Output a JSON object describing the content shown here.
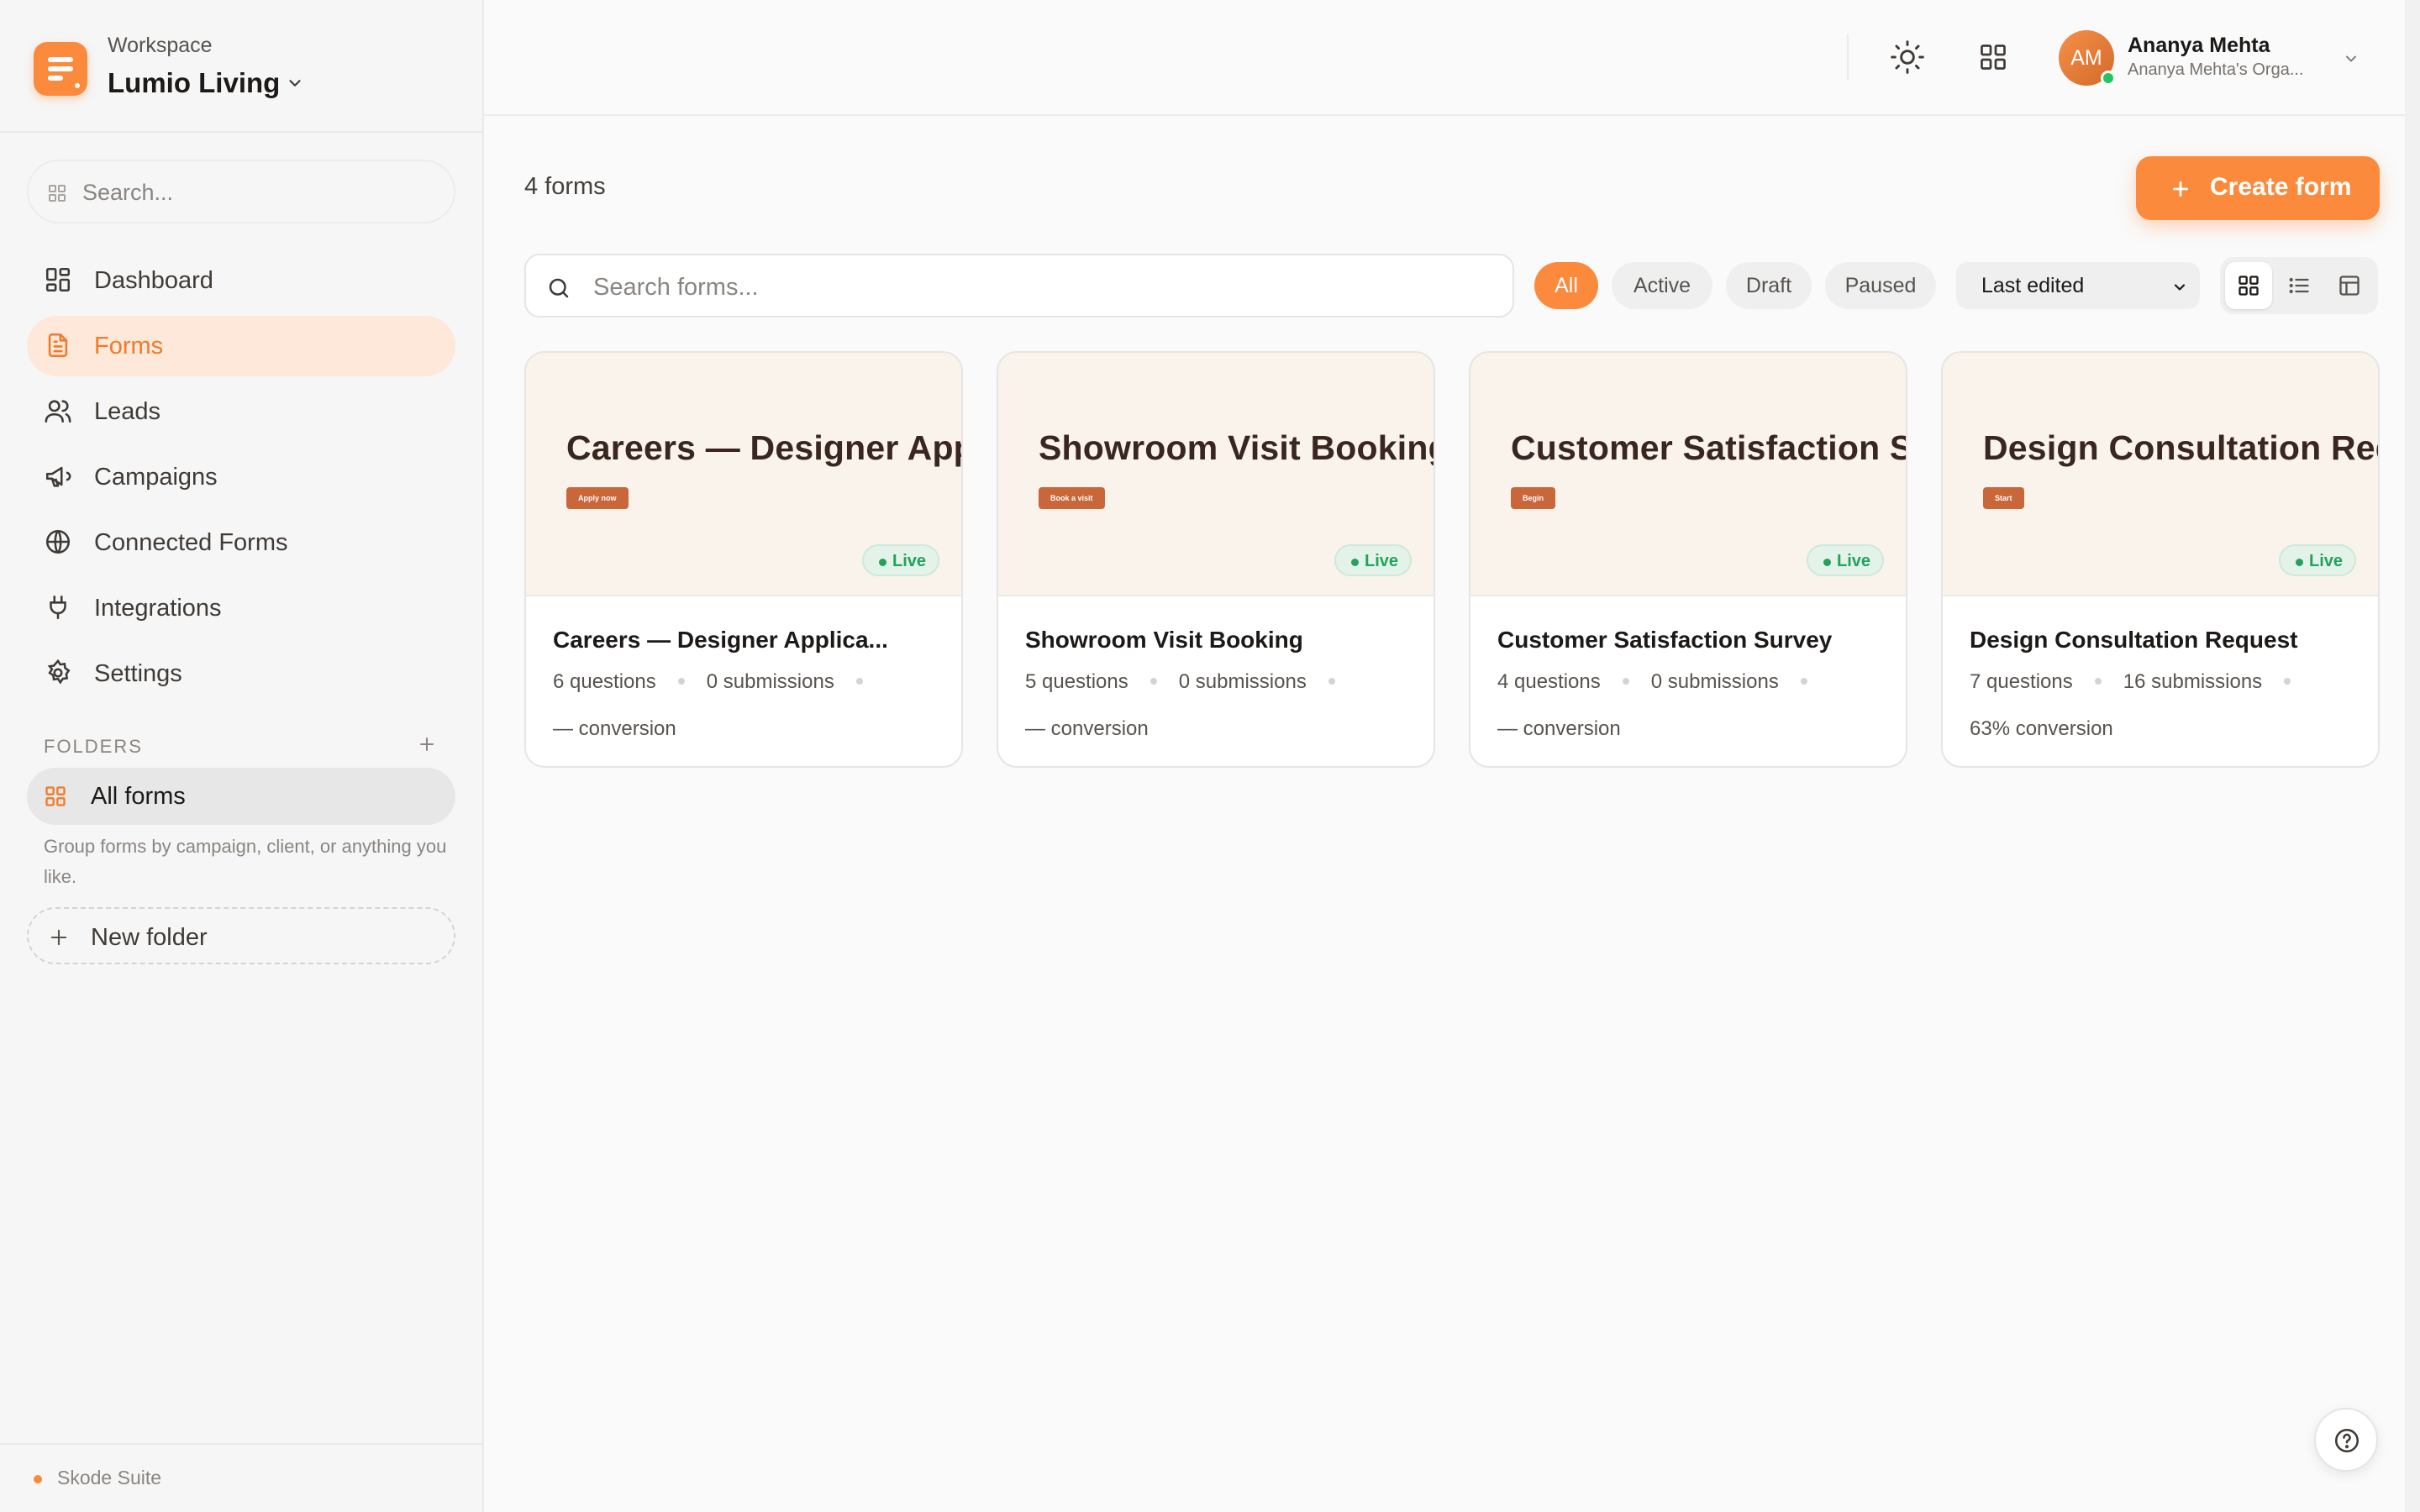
{
  "colors": {
    "accent": "#fb8a3c",
    "live": "#22a35a",
    "preview_bg": "#faf3ec",
    "preview_btn": "#c9663a"
  },
  "workspace": {
    "label": "Workspace",
    "name": "Lumio Living"
  },
  "sidebar": {
    "search_placeholder": "Search...",
    "nav": [
      {
        "label": "Dashboard",
        "icon": "dashboard-icon"
      },
      {
        "label": "Forms",
        "icon": "form-document-icon",
        "active": true
      },
      {
        "label": "Leads",
        "icon": "users-icon"
      },
      {
        "label": "Campaigns",
        "icon": "megaphone-icon"
      },
      {
        "label": "Connected Forms",
        "icon": "globe-icon"
      },
      {
        "label": "Integrations",
        "icon": "plug-icon"
      },
      {
        "label": "Settings",
        "icon": "gear-icon"
      }
    ],
    "folders_label": "FOLDERS",
    "all_forms_label": "All forms",
    "folders_help": "Group forms by campaign, client, or anything you like.",
    "new_folder_label": "New folder",
    "footer_brand": "Skode Suite"
  },
  "topbar": {
    "user_initials": "AM",
    "user_name": "Ananya Mehta",
    "user_org": "Ananya Mehta's Orga..."
  },
  "main": {
    "forms_count": "4 forms",
    "create_label": "Create form",
    "search_placeholder": "Search forms...",
    "filters": [
      "All",
      "Active",
      "Draft",
      "Paused"
    ],
    "active_filter": "All",
    "sort_value": "Last edited",
    "view_modes": [
      "grid-view-icon",
      "list-view-icon",
      "table-view-icon"
    ],
    "active_view": "grid-view-icon"
  },
  "cards": [
    {
      "preview_title": "Careers — Designer Application",
      "preview_button": "Apply now",
      "status": "Live",
      "name": "Careers — Designer Applica...",
      "questions": "6 questions",
      "submissions": "0 submissions",
      "conversion": "— conversion"
    },
    {
      "preview_title": "Showroom Visit Booking",
      "preview_button": "Book a visit",
      "status": "Live",
      "name": "Showroom Visit Booking",
      "questions": "5 questions",
      "submissions": "0 submissions",
      "conversion": "— conversion"
    },
    {
      "preview_title": "Customer Satisfaction Survey",
      "preview_button": "Begin",
      "status": "Live",
      "name": "Customer Satisfaction Survey",
      "questions": "4 questions",
      "submissions": "0 submissions",
      "conversion": "— conversion"
    },
    {
      "preview_title": "Design Consultation Request",
      "preview_button": "Start",
      "status": "Live",
      "name": "Design Consultation Request",
      "questions": "7 questions",
      "submissions": "16 submissions",
      "conversion": "63% conversion"
    }
  ]
}
